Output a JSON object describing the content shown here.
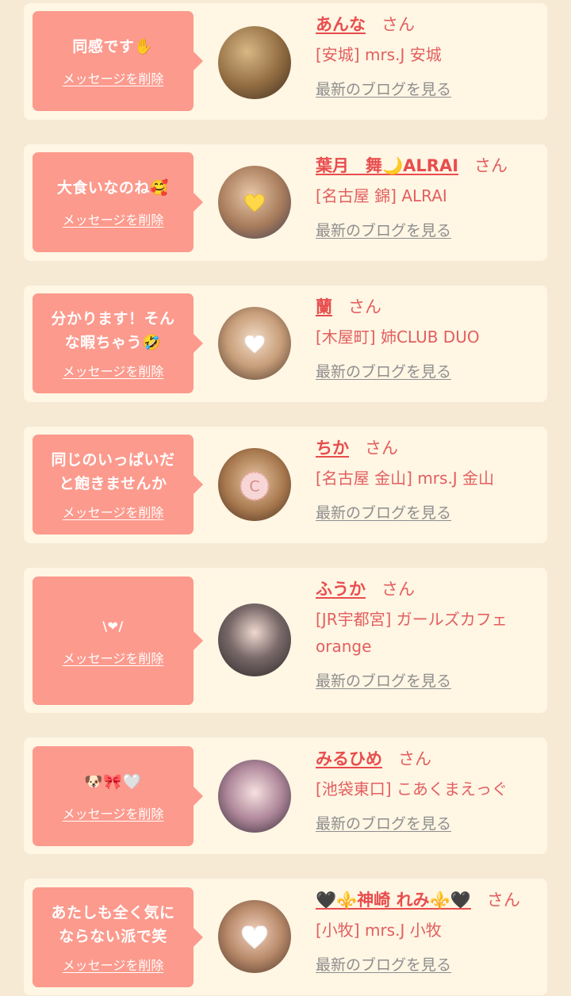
{
  "delete_label": "メッセージを削除",
  "san_label": "さん",
  "blog_label": "最新のブログを見る",
  "colors": {
    "page_bg": "#f6ead5",
    "card_bg": "#fff6e4",
    "bubble": "#fc9a8d",
    "name": "#e84d4d",
    "shop": "#e25f5f",
    "blog": "#8e8e8e"
  },
  "items": [
    {
      "message": "同感です✋",
      "name": "あんな",
      "shop": "[安城] mrs.J 安城"
    },
    {
      "message": "大食いなのね🥰",
      "name": "葉月　舞🌙ALRAI",
      "shop": "[名古屋 錦] ALRAI"
    },
    {
      "message": "分かります！そんな暇ちゃう🤣",
      "name": "蘭",
      "shop": "[木屋町] 姉CLUB DUO"
    },
    {
      "message": "同じのいっぱいだと飽きませんか",
      "name": "ちか",
      "shop": "[名古屋 金山] mrs.J 金山"
    },
    {
      "message": "\\❤/",
      "name": "ふうか",
      "shop": "[JR宇都宮] ガールズカフェorange"
    },
    {
      "message": "🐶🎀🤍",
      "name": "みるひめ",
      "shop": "[池袋東口] こあくまえっぐ"
    },
    {
      "message": "あたしも全く気にならない派で笑",
      "name": "🖤⚜️神崎 れみ⚜️🖤",
      "shop": "[小牧] mrs.J 小牧"
    }
  ]
}
